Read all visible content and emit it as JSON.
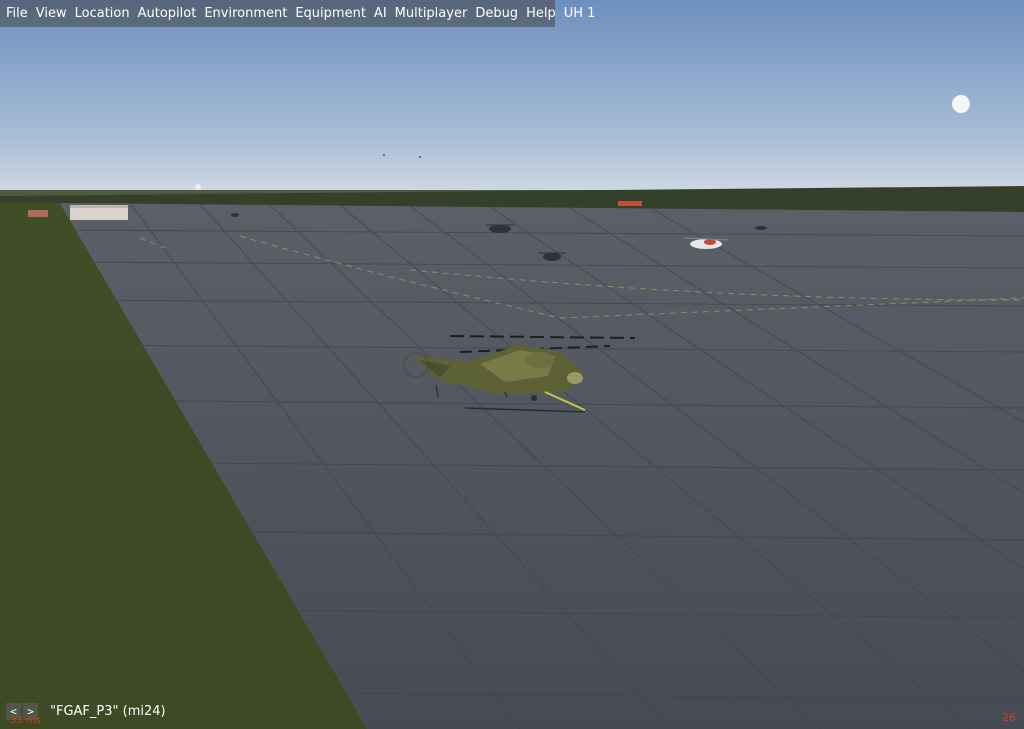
{
  "menubar": {
    "items": [
      "File",
      "View",
      "Location",
      "Autopilot",
      "Environment",
      "Equipment",
      "AI",
      "Multiplayer",
      "Debug",
      "Help",
      "UH 1"
    ]
  },
  "view": {
    "prev_label": "<",
    "next_label": ">",
    "label": "\"FGAF_P3\" (mi24)"
  },
  "status": {
    "frame_time": "33 ms",
    "fps": "26"
  },
  "colors": {
    "sky_top": "#6e8fc0",
    "sky_horizon": "#c9d6e2",
    "tarmac": "#4b5058",
    "grass": "#3d4a24",
    "status_text": "#d04010"
  }
}
